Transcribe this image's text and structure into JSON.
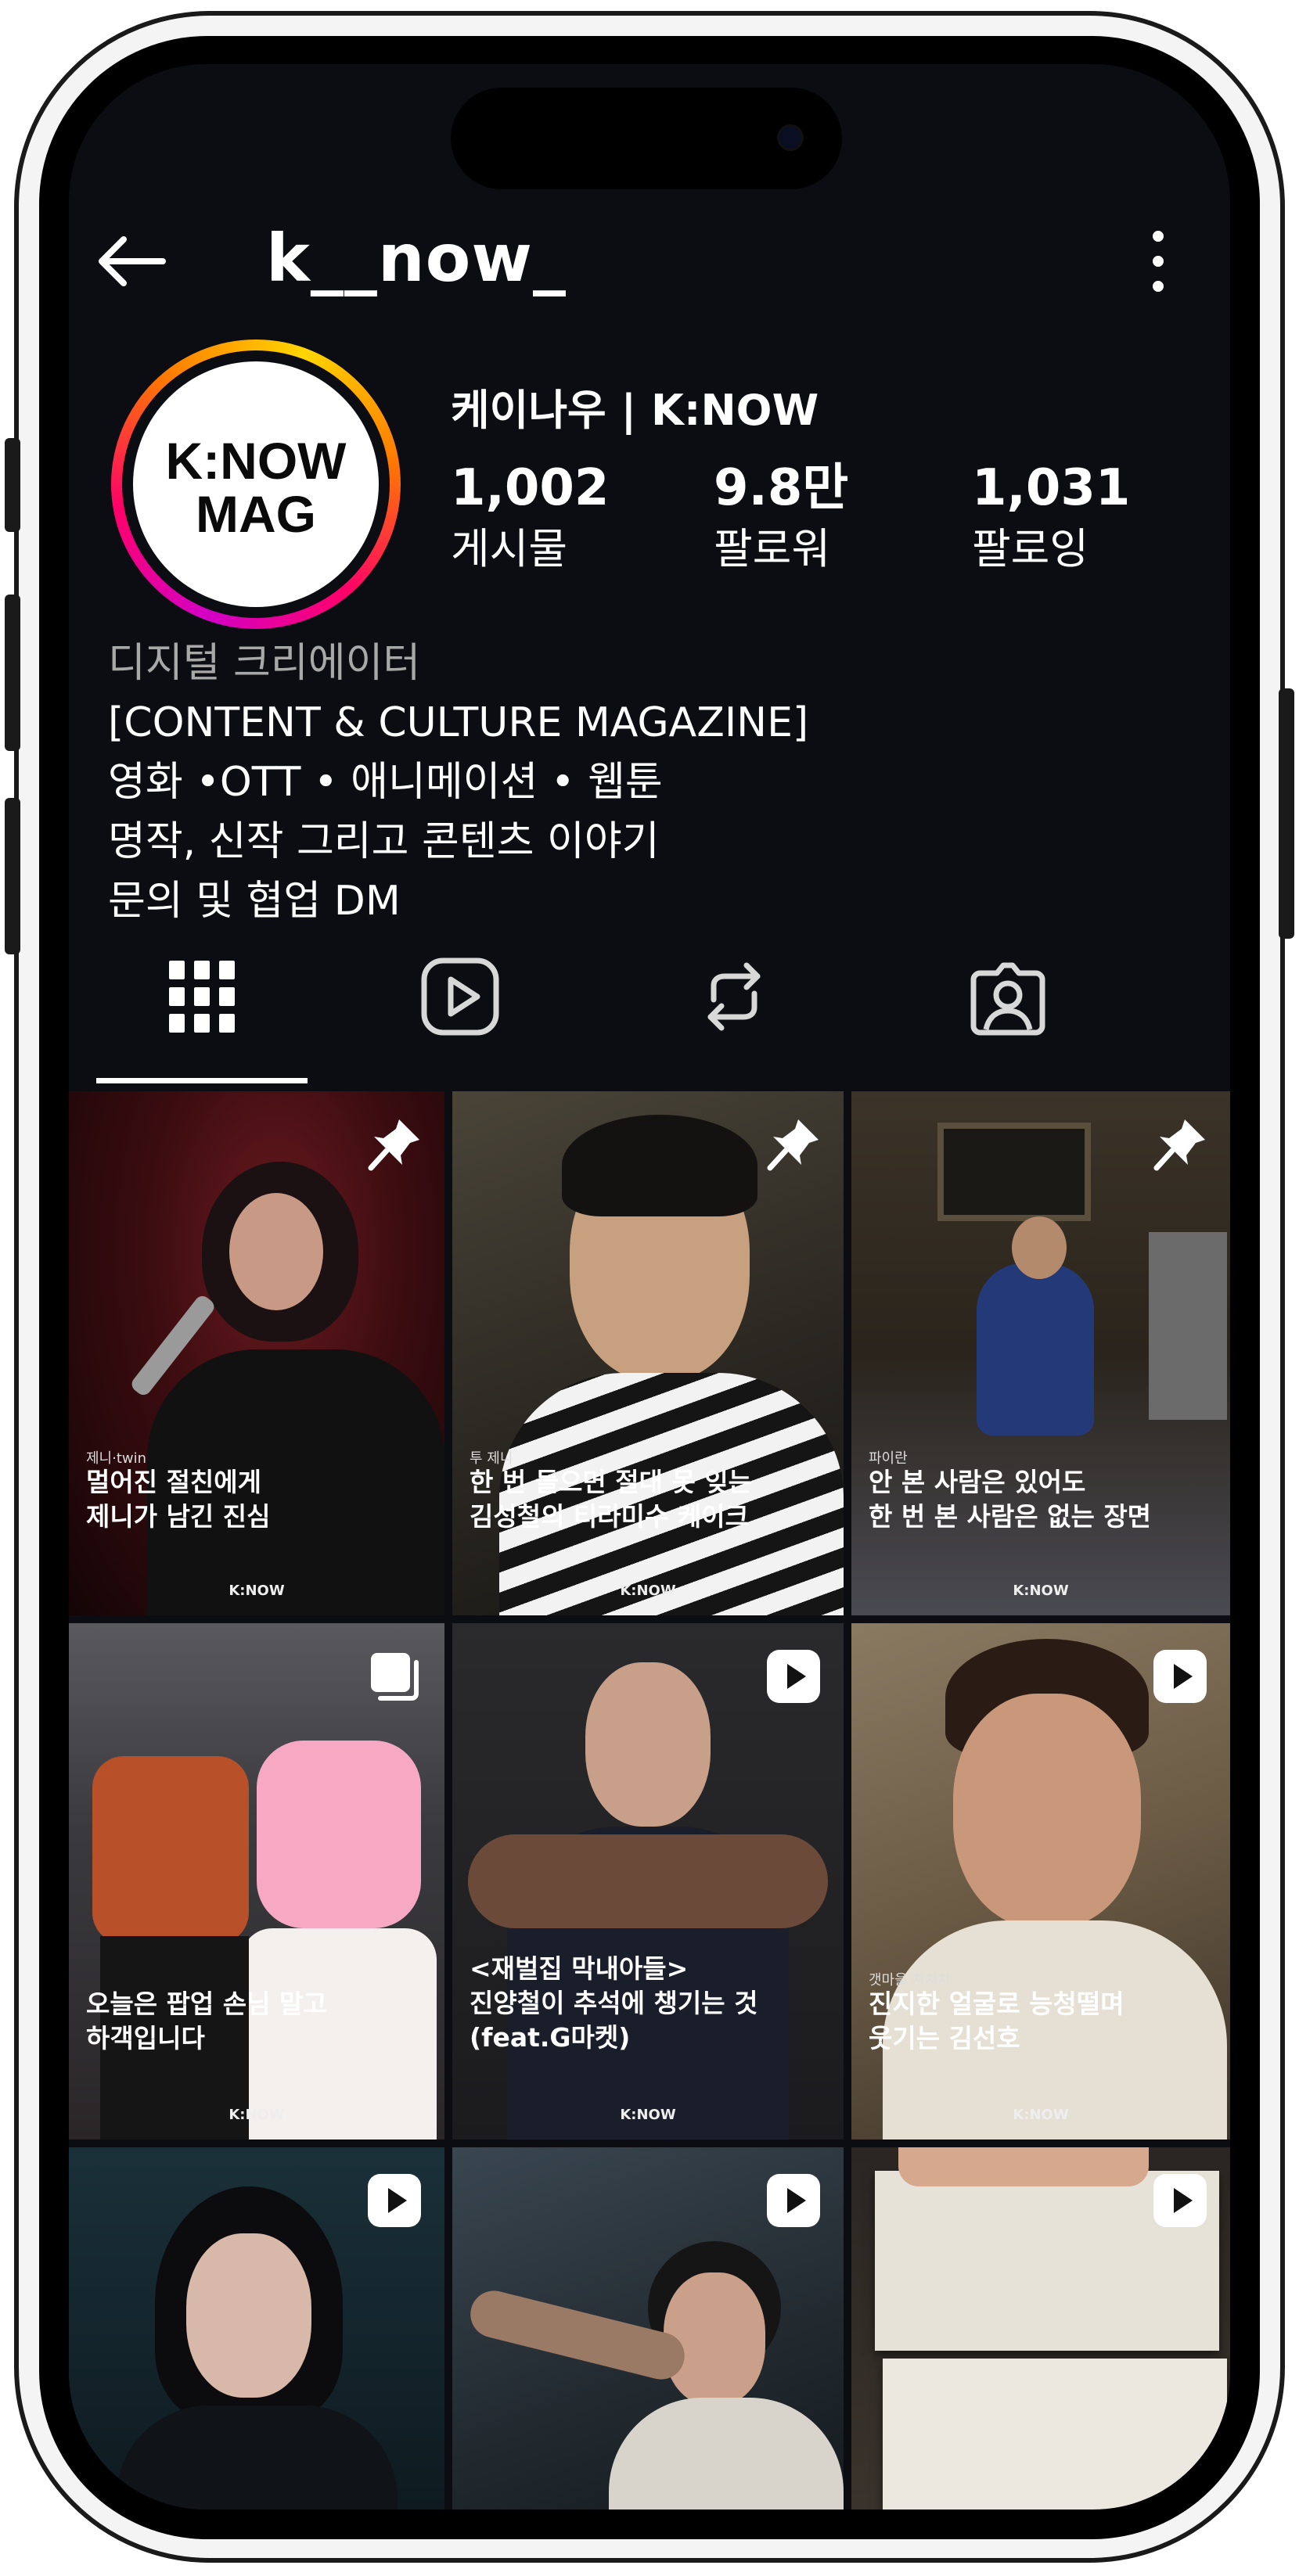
{
  "header": {
    "username": "k__now_"
  },
  "profile": {
    "avatar_text_line1": "K:NOW",
    "avatar_text_line2": "MAG",
    "display_name": "케이나우 | K:NOW",
    "stats": [
      {
        "value": "1,002",
        "label": "게시물"
      },
      {
        "value": "9.8만",
        "label": "팔로워"
      },
      {
        "value": "1,031",
        "label": "팔로잉"
      }
    ],
    "category": "디지털 크리에이터",
    "bio_lines": [
      "[CONTENT & CULTURE  MAGAZINE]",
      "영화 •OTT • 애니메이션 • 웹툰",
      "명작, 신작 그리고 콘텐츠 이야기",
      "문의 및 협업 DM"
    ]
  },
  "tabs": [
    {
      "icon": "grid-icon",
      "active": true
    },
    {
      "icon": "reels-icon",
      "active": false
    },
    {
      "icon": "reposts-icon",
      "active": false
    },
    {
      "icon": "tagged-icon",
      "active": false
    }
  ],
  "posts": [
    {
      "badge": "pin-icon",
      "tag": "제니·twin",
      "caption": "멀어진 절친에게\n제니가 남긴 진심",
      "logo": "K:NOW"
    },
    {
      "badge": "pin-icon",
      "tag": "투 제니",
      "caption": "한 번 들으면 절대 못 잊는\n김성철의 티라미수 케이크",
      "logo": "K:NOW"
    },
    {
      "badge": "pin-icon",
      "tag": "파이란",
      "caption": "안 본 사람은 있어도\n한 번 본 사람은 없는 장면",
      "logo": "K:NOW"
    },
    {
      "badge": "carousel-icon",
      "tag": "",
      "caption": "오늘은 팝업 손님 말고\n하객입니다",
      "logo": "K:NOW"
    },
    {
      "badge": "reels-icon",
      "tag": "",
      "caption": "<재벌집 막내아들>\n진양철이 추석에 챙기는 것\n(feat.G마켓)",
      "logo": "K:NOW"
    },
    {
      "badge": "reels-icon",
      "tag": "갯마을 차차차",
      "caption": "진지한 얼굴로 능청떨며\n웃기는 김선호",
      "logo": "K:NOW"
    },
    {
      "badge": "reels-icon",
      "tag": "",
      "caption": "",
      "logo": ""
    },
    {
      "badge": "reels-icon",
      "tag": "",
      "caption": "",
      "logo": ""
    },
    {
      "badge": "reels-icon",
      "tag": "",
      "caption": "",
      "logo": ""
    }
  ],
  "colors": {
    "background": "#0b0d12",
    "text_primary": "#ffffff",
    "text_secondary": "#a8a8a8",
    "story_ring": [
      "#d300c5",
      "#ff0069",
      "#ff7a00",
      "#ffd600"
    ]
  }
}
